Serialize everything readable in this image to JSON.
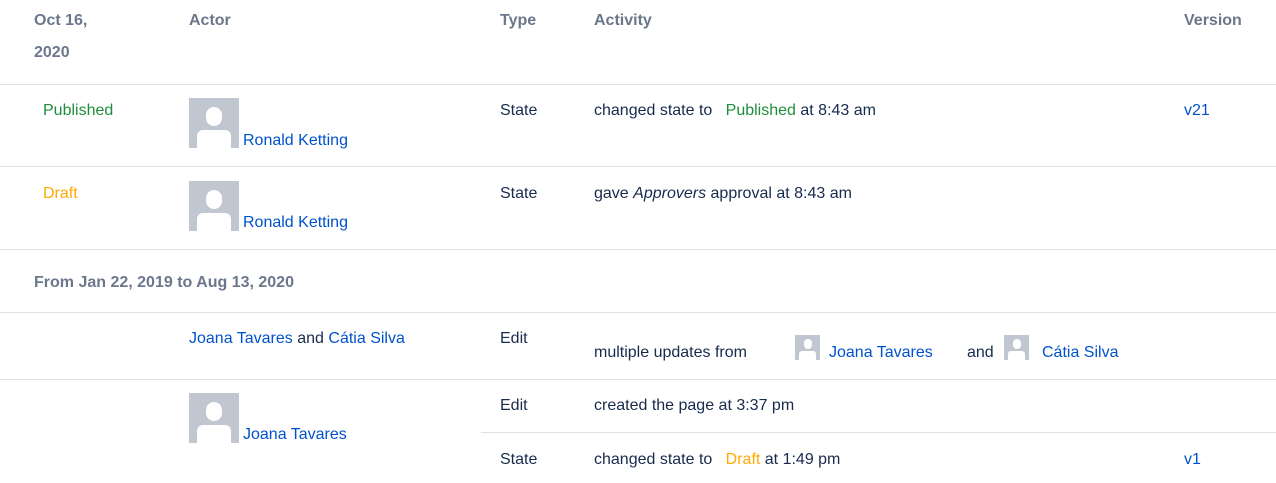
{
  "header": {
    "date_line1": "Oct 16,",
    "date_line2": "2020",
    "actor": "Actor",
    "type": "Type",
    "activity": "Activity",
    "version": "Version"
  },
  "rows": [
    {
      "state": "Published",
      "actor": "Ronald Ketting",
      "type": "State",
      "activity_prefix": "changed state to",
      "activity_state": "Published",
      "activity_suffix": "at 8:43 am",
      "version": "v21"
    },
    {
      "state": "Draft",
      "actor": "Ronald Ketting",
      "type": "State",
      "activity_prefix": "gave",
      "activity_emph": "Approvers",
      "activity_suffix": "approval at 8:43 am"
    }
  ],
  "group2": {
    "range": "From Jan 22, 2019 to Aug 13, 2020",
    "row1": {
      "actor1": "Joana Tavares",
      "and": "and",
      "actor2": "Cátia Silva",
      "type": "Edit",
      "activity_prefix": "multiple updates from",
      "user1": "Joana Tavares",
      "and2": "and",
      "user2": "Cátia Silva"
    },
    "row2": {
      "actor": "Joana Tavares",
      "sub1": {
        "type": "Edit",
        "activity": "created the page at 3:37 pm"
      },
      "sub2": {
        "type": "State",
        "activity_prefix": "changed state to",
        "activity_state": "Draft",
        "activity_suffix": "at 1:49 pm",
        "version": "v1"
      }
    }
  },
  "colors": {
    "link": "#0052cc",
    "published": "#1e8e3e",
    "draft": "#ffab00",
    "header": "#6b778c"
  }
}
